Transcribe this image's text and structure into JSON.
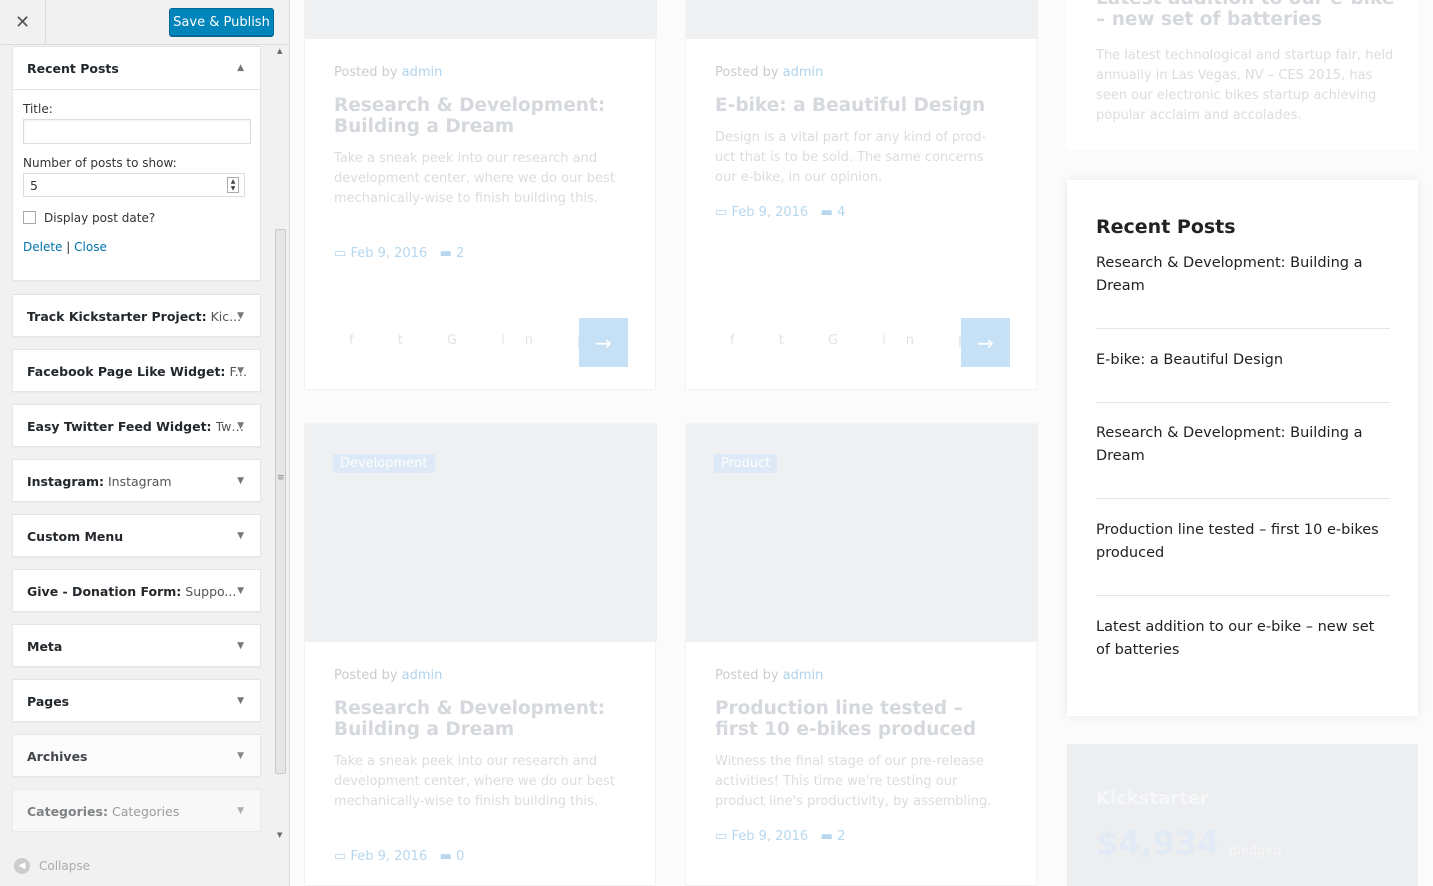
{
  "toolbar": {
    "close_glyph": "✕",
    "publish_label": "Save & Publish"
  },
  "active_widget": {
    "title": "Recent Posts",
    "title_field_label": "Title:",
    "title_value": "",
    "num_label": "Number of posts to show:",
    "num_value": "5",
    "show_date_label": "Display post date?",
    "delete_label": "Delete",
    "sep": "|",
    "close_label": "Close"
  },
  "widgets": [
    {
      "name": "Track Kickstarter Project:",
      "sub": "Kic..."
    },
    {
      "name": "Facebook Page Like Widget:",
      "sub": "F..."
    },
    {
      "name": "Easy Twitter Feed Widget:",
      "sub": "Twi..."
    },
    {
      "name": "Instagram:",
      "sub": "Instagram"
    },
    {
      "name": "Custom Menu",
      "sub": ""
    },
    {
      "name": "Give - Donation Form:",
      "sub": "Suppo..."
    },
    {
      "name": "Meta",
      "sub": ""
    },
    {
      "name": "Pages",
      "sub": ""
    },
    {
      "name": "Archives",
      "sub": ""
    },
    {
      "name": "Categories:",
      "sub": "Categories"
    }
  ],
  "collapse_label": "Collapse",
  "preview": {
    "cards": [
      {
        "posted": "Posted by",
        "author": "admin",
        "title": "Research & Development: Building a Dream",
        "excerpt": "Take a sneak peek into our research and development center, where we do our best mechanically-wise to finish building this.",
        "date": "Feb 9, 2016",
        "comments": "2"
      },
      {
        "posted": "Posted by",
        "author": "admin",
        "title": "E-bike: a Beautiful Design",
        "excerpt": "Design is a vital part for any kind of prod- uct that is to be sold. The same concerns our e-bike, in our opinion.",
        "date": "Feb 9, 2016",
        "comments": "4"
      },
      {
        "tag": "Development",
        "posted": "Posted by",
        "author": "admin",
        "title": "Research & Development: Building a Dream",
        "excerpt": "Take a sneak peek into our research and development center, where we do our best mechanically-wise to finish building this.",
        "date": "Feb 9, 2016",
        "comments": "0"
      },
      {
        "tag": "Product",
        "posted": "Posted by",
        "author": "admin",
        "title": "Production line tested – first 10 e-bikes produced",
        "excerpt": "Witness the final stage of our pre-release activities! This time we're testing our product line's productivity, by assembling.",
        "date": "Feb 9, 2016",
        "comments": "2"
      }
    ],
    "top_right": {
      "title": "Latest addition to our e-bike – new set of batteries",
      "excerpt": "The latest technological and startup fair, held annually in Las Vegas, NV – CES 2015, has seen our electronic bikes startup achieving popular acclaim and accolades."
    },
    "recent_posts": {
      "title": "Recent Posts",
      "items": [
        "Research & Development: Building a Dream",
        "E-bike: a Beautiful Design",
        "Research & Development: Building a Dream",
        "Production line tested – first 10 e-bikes produced",
        "Latest addition to our e-bike – new set of batteries"
      ]
    },
    "kickstarter": {
      "title": "Kickstarter",
      "amount": "$4,934",
      "pledged": "pledged"
    }
  }
}
